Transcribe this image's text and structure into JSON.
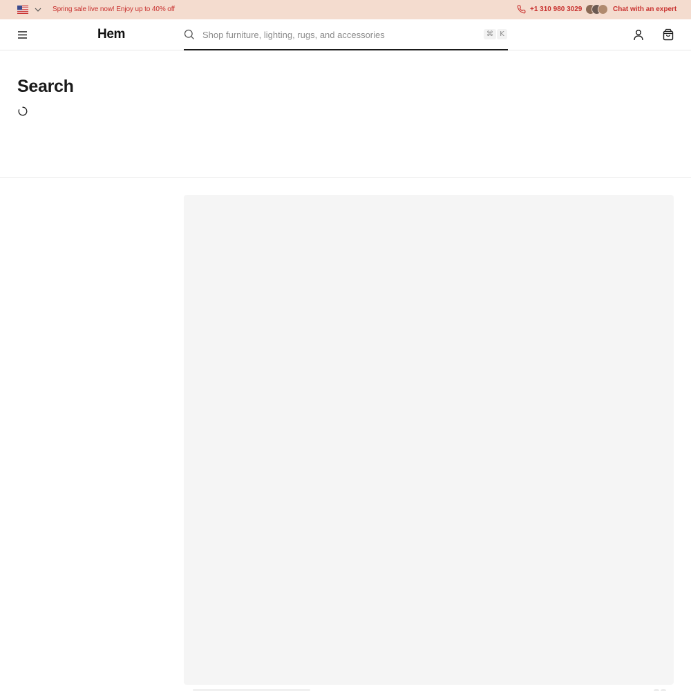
{
  "topbar": {
    "promo": "Spring sale live now! Enjoy up to 40% off",
    "phone": "+1 310 980 3029",
    "chat": "Chat with an expert",
    "region_icon": "us-flag-icon",
    "accent_color": "#c8302e",
    "background_color": "#f4dccf"
  },
  "header": {
    "logo": "Hem",
    "menu_icon": "hamburger-menu-icon",
    "search": {
      "placeholder": "Shop furniture, lighting, rugs, and accessories",
      "value": "",
      "shortcut_modifier": "⌘",
      "shortcut_key": "K"
    },
    "account_icon": "user-icon",
    "cart_icon": "shopping-bag-icon"
  },
  "main": {
    "title": "Search",
    "loading": true
  }
}
